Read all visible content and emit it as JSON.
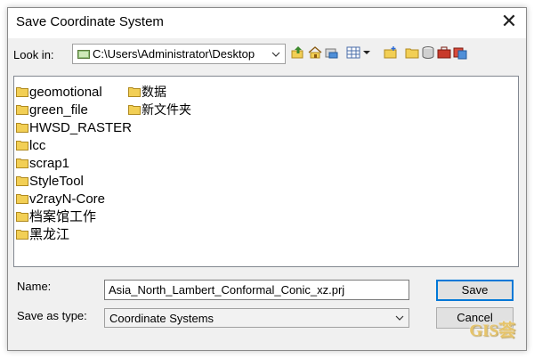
{
  "window": {
    "title": "Save Coordinate System",
    "close_glyph": "✕"
  },
  "look_in": {
    "label": "Look in:",
    "path": "C:\\Users\\Administrator\\Desktop"
  },
  "toolbar": {
    "icons": [
      "up-folder-icon",
      "home-icon",
      "connect-folder-icon",
      "view-list-icon",
      "new-folder-icon",
      "folder-icon",
      "database-icon",
      "toolbox-icon",
      "catalog-icon"
    ]
  },
  "files": {
    "col1": [
      "geomotional",
      "green_file",
      "HWSD_RASTER",
      "lcc",
      "scrap1",
      "StyleTool",
      "v2rayN-Core",
      "档案馆工作",
      "黑龙江"
    ],
    "col2": [
      "数据",
      "新文件夹"
    ]
  },
  "form": {
    "name_label": "Name:",
    "name_value": "Asia_North_Lambert_Conformal_Conic_xz.prj",
    "type_label": "Save as type:",
    "type_value": "Coordinate Systems"
  },
  "buttons": {
    "save": "Save",
    "cancel": "Cancel"
  },
  "watermark": "GIS荟",
  "colors": {
    "folder": "#f2cf55",
    "accent": "#0078d7"
  }
}
